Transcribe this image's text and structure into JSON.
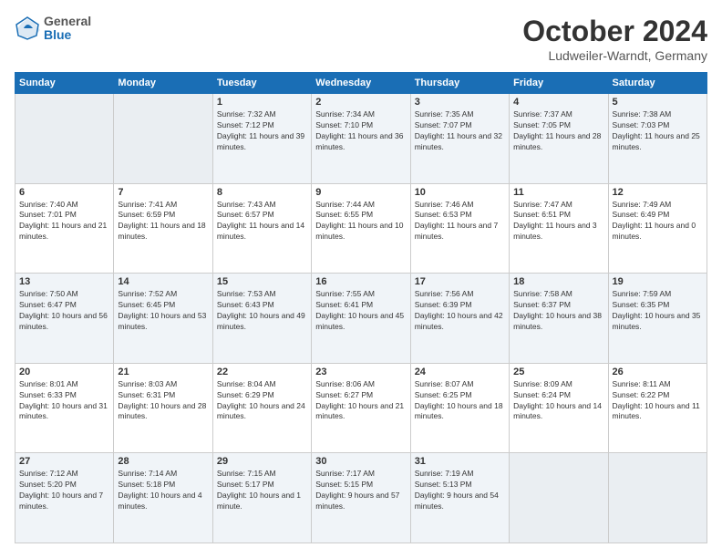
{
  "header": {
    "logo": {
      "general": "General",
      "blue": "Blue"
    },
    "title": "October 2024",
    "location": "Ludweiler-Warndt, Germany"
  },
  "days_of_week": [
    "Sunday",
    "Monday",
    "Tuesday",
    "Wednesday",
    "Thursday",
    "Friday",
    "Saturday"
  ],
  "weeks": [
    [
      {
        "day": "",
        "info": ""
      },
      {
        "day": "",
        "info": ""
      },
      {
        "day": "1",
        "info": "Sunrise: 7:32 AM\nSunset: 7:12 PM\nDaylight: 11 hours and 39 minutes."
      },
      {
        "day": "2",
        "info": "Sunrise: 7:34 AM\nSunset: 7:10 PM\nDaylight: 11 hours and 36 minutes."
      },
      {
        "day": "3",
        "info": "Sunrise: 7:35 AM\nSunset: 7:07 PM\nDaylight: 11 hours and 32 minutes."
      },
      {
        "day": "4",
        "info": "Sunrise: 7:37 AM\nSunset: 7:05 PM\nDaylight: 11 hours and 28 minutes."
      },
      {
        "day": "5",
        "info": "Sunrise: 7:38 AM\nSunset: 7:03 PM\nDaylight: 11 hours and 25 minutes."
      }
    ],
    [
      {
        "day": "6",
        "info": "Sunrise: 7:40 AM\nSunset: 7:01 PM\nDaylight: 11 hours and 21 minutes."
      },
      {
        "day": "7",
        "info": "Sunrise: 7:41 AM\nSunset: 6:59 PM\nDaylight: 11 hours and 18 minutes."
      },
      {
        "day": "8",
        "info": "Sunrise: 7:43 AM\nSunset: 6:57 PM\nDaylight: 11 hours and 14 minutes."
      },
      {
        "day": "9",
        "info": "Sunrise: 7:44 AM\nSunset: 6:55 PM\nDaylight: 11 hours and 10 minutes."
      },
      {
        "day": "10",
        "info": "Sunrise: 7:46 AM\nSunset: 6:53 PM\nDaylight: 11 hours and 7 minutes."
      },
      {
        "day": "11",
        "info": "Sunrise: 7:47 AM\nSunset: 6:51 PM\nDaylight: 11 hours and 3 minutes."
      },
      {
        "day": "12",
        "info": "Sunrise: 7:49 AM\nSunset: 6:49 PM\nDaylight: 11 hours and 0 minutes."
      }
    ],
    [
      {
        "day": "13",
        "info": "Sunrise: 7:50 AM\nSunset: 6:47 PM\nDaylight: 10 hours and 56 minutes."
      },
      {
        "day": "14",
        "info": "Sunrise: 7:52 AM\nSunset: 6:45 PM\nDaylight: 10 hours and 53 minutes."
      },
      {
        "day": "15",
        "info": "Sunrise: 7:53 AM\nSunset: 6:43 PM\nDaylight: 10 hours and 49 minutes."
      },
      {
        "day": "16",
        "info": "Sunrise: 7:55 AM\nSunset: 6:41 PM\nDaylight: 10 hours and 45 minutes."
      },
      {
        "day": "17",
        "info": "Sunrise: 7:56 AM\nSunset: 6:39 PM\nDaylight: 10 hours and 42 minutes."
      },
      {
        "day": "18",
        "info": "Sunrise: 7:58 AM\nSunset: 6:37 PM\nDaylight: 10 hours and 38 minutes."
      },
      {
        "day": "19",
        "info": "Sunrise: 7:59 AM\nSunset: 6:35 PM\nDaylight: 10 hours and 35 minutes."
      }
    ],
    [
      {
        "day": "20",
        "info": "Sunrise: 8:01 AM\nSunset: 6:33 PM\nDaylight: 10 hours and 31 minutes."
      },
      {
        "day": "21",
        "info": "Sunrise: 8:03 AM\nSunset: 6:31 PM\nDaylight: 10 hours and 28 minutes."
      },
      {
        "day": "22",
        "info": "Sunrise: 8:04 AM\nSunset: 6:29 PM\nDaylight: 10 hours and 24 minutes."
      },
      {
        "day": "23",
        "info": "Sunrise: 8:06 AM\nSunset: 6:27 PM\nDaylight: 10 hours and 21 minutes."
      },
      {
        "day": "24",
        "info": "Sunrise: 8:07 AM\nSunset: 6:25 PM\nDaylight: 10 hours and 18 minutes."
      },
      {
        "day": "25",
        "info": "Sunrise: 8:09 AM\nSunset: 6:24 PM\nDaylight: 10 hours and 14 minutes."
      },
      {
        "day": "26",
        "info": "Sunrise: 8:11 AM\nSunset: 6:22 PM\nDaylight: 10 hours and 11 minutes."
      }
    ],
    [
      {
        "day": "27",
        "info": "Sunrise: 7:12 AM\nSunset: 5:20 PM\nDaylight: 10 hours and 7 minutes."
      },
      {
        "day": "28",
        "info": "Sunrise: 7:14 AM\nSunset: 5:18 PM\nDaylight: 10 hours and 4 minutes."
      },
      {
        "day": "29",
        "info": "Sunrise: 7:15 AM\nSunset: 5:17 PM\nDaylight: 10 hours and 1 minute."
      },
      {
        "day": "30",
        "info": "Sunrise: 7:17 AM\nSunset: 5:15 PM\nDaylight: 9 hours and 57 minutes."
      },
      {
        "day": "31",
        "info": "Sunrise: 7:19 AM\nSunset: 5:13 PM\nDaylight: 9 hours and 54 minutes."
      },
      {
        "day": "",
        "info": ""
      },
      {
        "day": "",
        "info": ""
      }
    ]
  ]
}
